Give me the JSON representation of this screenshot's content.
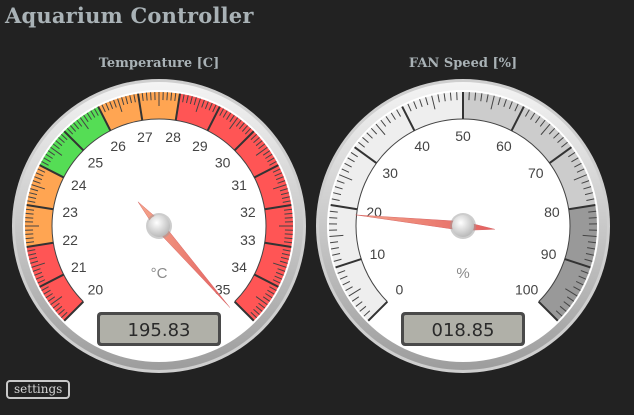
{
  "app": {
    "title": "Aquarium Controller"
  },
  "temperature_gauge": {
    "title": "Temperature [C]",
    "unit": "°C",
    "min": 20,
    "max": 35,
    "ticks": [
      "20",
      "21",
      "22",
      "23",
      "24",
      "25",
      "26",
      "27",
      "28",
      "29",
      "30",
      "31",
      "32",
      "33",
      "34",
      "35"
    ],
    "value": 195.83,
    "readout": "195.83",
    "bands": [
      {
        "from": 20,
        "to": 22,
        "color": "#ff5555"
      },
      {
        "from": 22,
        "to": 24,
        "color": "#ffa552"
      },
      {
        "from": 24,
        "to": 26,
        "color": "#55dd55"
      },
      {
        "from": 26,
        "to": 28,
        "color": "#ffa552"
      },
      {
        "from": 28,
        "to": 35,
        "color": "#ff5555"
      }
    ]
  },
  "fan_gauge": {
    "title": "FAN Speed [%]",
    "unit": "%",
    "min": 0,
    "max": 100,
    "ticks": [
      "0",
      "10",
      "20",
      "30",
      "40",
      "50",
      "60",
      "70",
      "80",
      "90",
      "100"
    ],
    "value": 18.85,
    "readout": "018.85",
    "bands": [
      {
        "from": 0,
        "to": 50,
        "color": "#eeeeee"
      },
      {
        "from": 50,
        "to": 80,
        "color": "#cccccc"
      },
      {
        "from": 80,
        "to": 100,
        "color": "#999999"
      }
    ]
  },
  "settings": {
    "label": "settings"
  },
  "colors": {
    "background": "#222222",
    "title_text": "#a9b2b6",
    "needle": "#f08080",
    "lcd_background": "#b0b0a8"
  }
}
